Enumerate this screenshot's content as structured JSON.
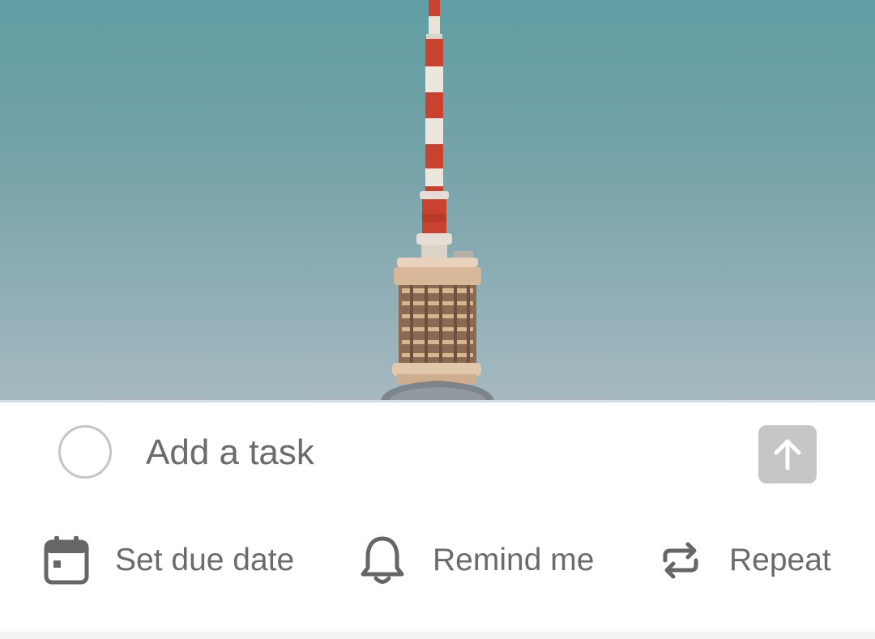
{
  "composer": {
    "task_placeholder": "Add a task",
    "actions": {
      "due_date_label": "Set due date",
      "remind_label": "Remind me",
      "repeat_label": "Repeat"
    }
  },
  "icons": {
    "complete": "circle-outline-icon",
    "submit": "arrow-up-icon",
    "due_date": "calendar-icon",
    "remind": "bell-icon",
    "repeat": "repeat-icon"
  },
  "colors": {
    "sky_top": "#5f9ea2",
    "sky_bottom": "#a6b9c0",
    "tower_red": "#c8422f",
    "text_gray": "#6b6b6b",
    "disabled_button": "#c6c6c6"
  }
}
